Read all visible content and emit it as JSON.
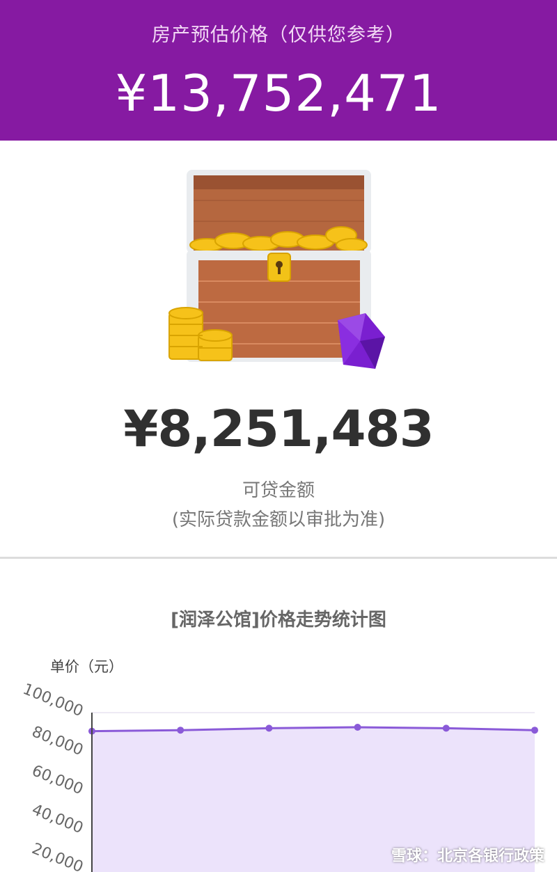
{
  "header": {
    "label": "房产预估价格（仅供您参考）",
    "estimated_price": "¥13,752,471"
  },
  "loan": {
    "amount": "¥8,251,483",
    "label": "可贷金额",
    "note": "(实际贷款金额以审批为准)"
  },
  "chart_data": {
    "type": "area",
    "title": "[润泽公馆]价格走势统计图",
    "ylabel": "单价（元）",
    "ylim": [
      0,
      100000
    ],
    "y_ticks": [
      "100,000",
      "80,000",
      "60,000",
      "40,000",
      "20,000"
    ],
    "series": [
      {
        "values": [
          90500,
          91000,
          92000,
          92500,
          92000,
          91000
        ]
      }
    ]
  },
  "watermark": "雪球：北京各银行政策",
  "colors": {
    "header_bg": "#861aa2",
    "line": "#8a5ad8",
    "area_fill": "#ece3fb"
  }
}
